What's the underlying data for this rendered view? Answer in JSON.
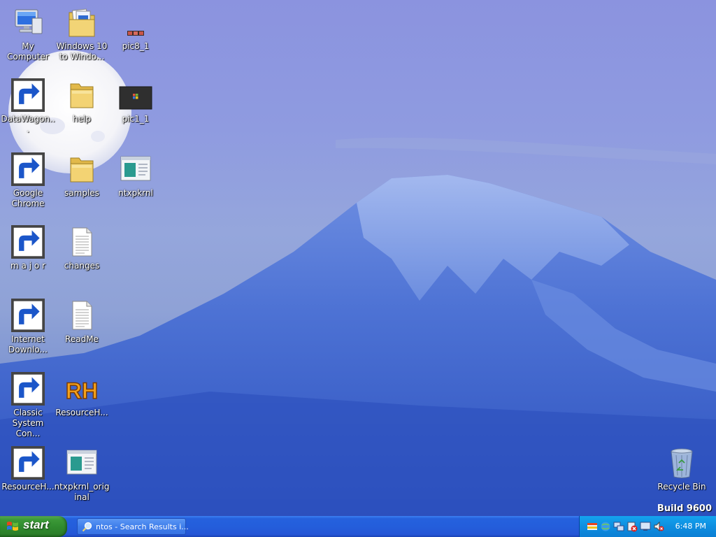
{
  "desktop": {
    "icons": [
      {
        "label": "My Computer",
        "type": "computer",
        "shortcut": false
      },
      {
        "label": "Windows 10 to Windo...",
        "type": "folder-docs",
        "shortcut": false
      },
      {
        "label": "pic8_1",
        "type": "image-thumb",
        "shortcut": false
      },
      {
        "label": "DataWagon...",
        "type": "star-app",
        "shortcut": true
      },
      {
        "label": "help",
        "type": "folder",
        "shortcut": false
      },
      {
        "label": "pic1_1",
        "type": "dark-thumb",
        "shortcut": false
      },
      {
        "label": "Google Chrome",
        "type": "chrome",
        "shortcut": true
      },
      {
        "label": "samples",
        "type": "folder",
        "shortcut": false
      },
      {
        "label": "ntxpkrnl",
        "type": "window-app",
        "shortcut": false
      },
      {
        "label": "m a j o r",
        "type": "vinyl",
        "shortcut": true
      },
      {
        "label": "changes",
        "type": "document",
        "shortcut": false
      },
      {
        "label": "Internet Downlo...",
        "type": "globe-download",
        "shortcut": true
      },
      {
        "label": "ReadMe",
        "type": "document",
        "shortcut": false
      },
      {
        "label": "Classic System Con...",
        "type": "control-panel",
        "shortcut": true
      },
      {
        "label": "ResourceH...",
        "type": "rh-logo",
        "shortcut": false
      },
      {
        "label": "ResourceH...",
        "type": "gear-doc",
        "shortcut": true
      },
      {
        "label": "ntxpkrnl_original",
        "type": "window-app",
        "shortcut": false
      },
      {
        "label": "Recycle Bin",
        "type": "recycle-bin",
        "shortcut": false
      }
    ],
    "build_text": "Build 9600"
  },
  "taskbar": {
    "start_label": "start",
    "task_item_label": "ntos - Search Results i...",
    "clock": "6:48 PM",
    "tray_icons": [
      "flag-tray-icon",
      "network-tray-icon",
      "monitor-tray-icon",
      "security-warning-tray-icon",
      "display-tray-icon",
      "volume-muted-tray-icon"
    ]
  },
  "colors": {
    "taskbar_blue": "#245edb",
    "start_green": "#2f8a2d",
    "tray_blue": "#0e8ee0"
  }
}
